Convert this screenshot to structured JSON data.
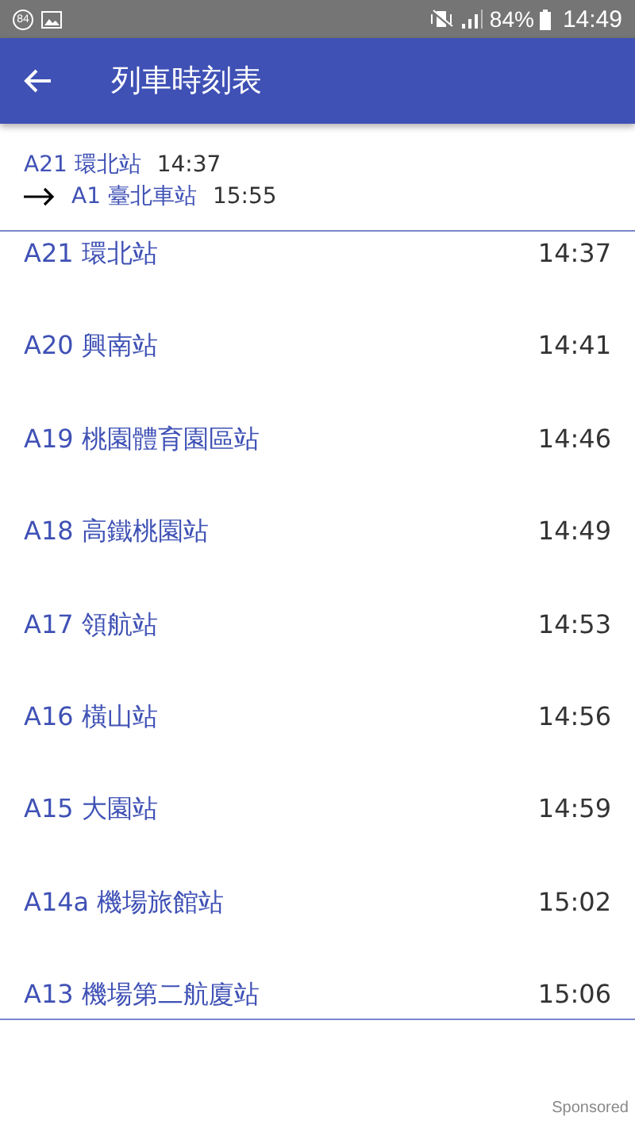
{
  "status_bar": {
    "notification_badge": "84",
    "battery": "84%",
    "time": "14:49"
  },
  "app_bar": {
    "title": "列車時刻表"
  },
  "trip": {
    "from_station": "A21 環北站",
    "from_time": "14:37",
    "to_station": "A1 臺北車站",
    "to_time": "15:55"
  },
  "stops": [
    {
      "station": "A21 環北站",
      "time": "14:37"
    },
    {
      "station": "A20 興南站",
      "time": "14:41"
    },
    {
      "station": "A19 桃園體育園區站",
      "time": "14:46"
    },
    {
      "station": "A18 高鐵桃園站",
      "time": "14:49"
    },
    {
      "station": "A17 領航站",
      "time": "14:53"
    },
    {
      "station": "A16 橫山站",
      "time": "14:56"
    },
    {
      "station": "A15 大園站",
      "time": "14:59"
    },
    {
      "station": "A14a 機場旅館站",
      "time": "15:02"
    },
    {
      "station": "A13 機場第二航廈站",
      "time": "15:06"
    }
  ],
  "ad": {
    "label": "Sponsored"
  }
}
